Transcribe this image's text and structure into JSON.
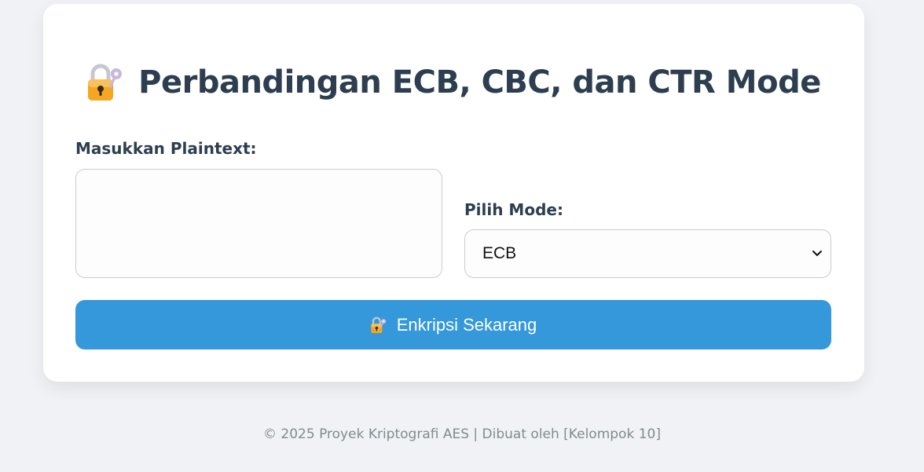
{
  "header": {
    "title": "Perbandingan ECB, CBC, dan CTR Mode",
    "icon": "locked-with-key-icon"
  },
  "form": {
    "plaintext_label": "Masukkan Plaintext:",
    "plaintext_value": "",
    "mode_label": "Pilih Mode:",
    "mode_selected": "ECB",
    "submit_label": "Enkripsi Sekarang",
    "submit_icon": "locked-with-key-icon"
  },
  "footer": {
    "text": "© 2025 Proyek Kriptografi AES | Dibuat oleh [Kelompok 10]"
  },
  "colors": {
    "background": "#f1f2f6",
    "card": "#ffffff",
    "heading": "#2c3e50",
    "accent": "#3498db",
    "footer_text": "#7f8c8d",
    "lock_body": "#f5a623",
    "key": "#b7a6c9"
  }
}
